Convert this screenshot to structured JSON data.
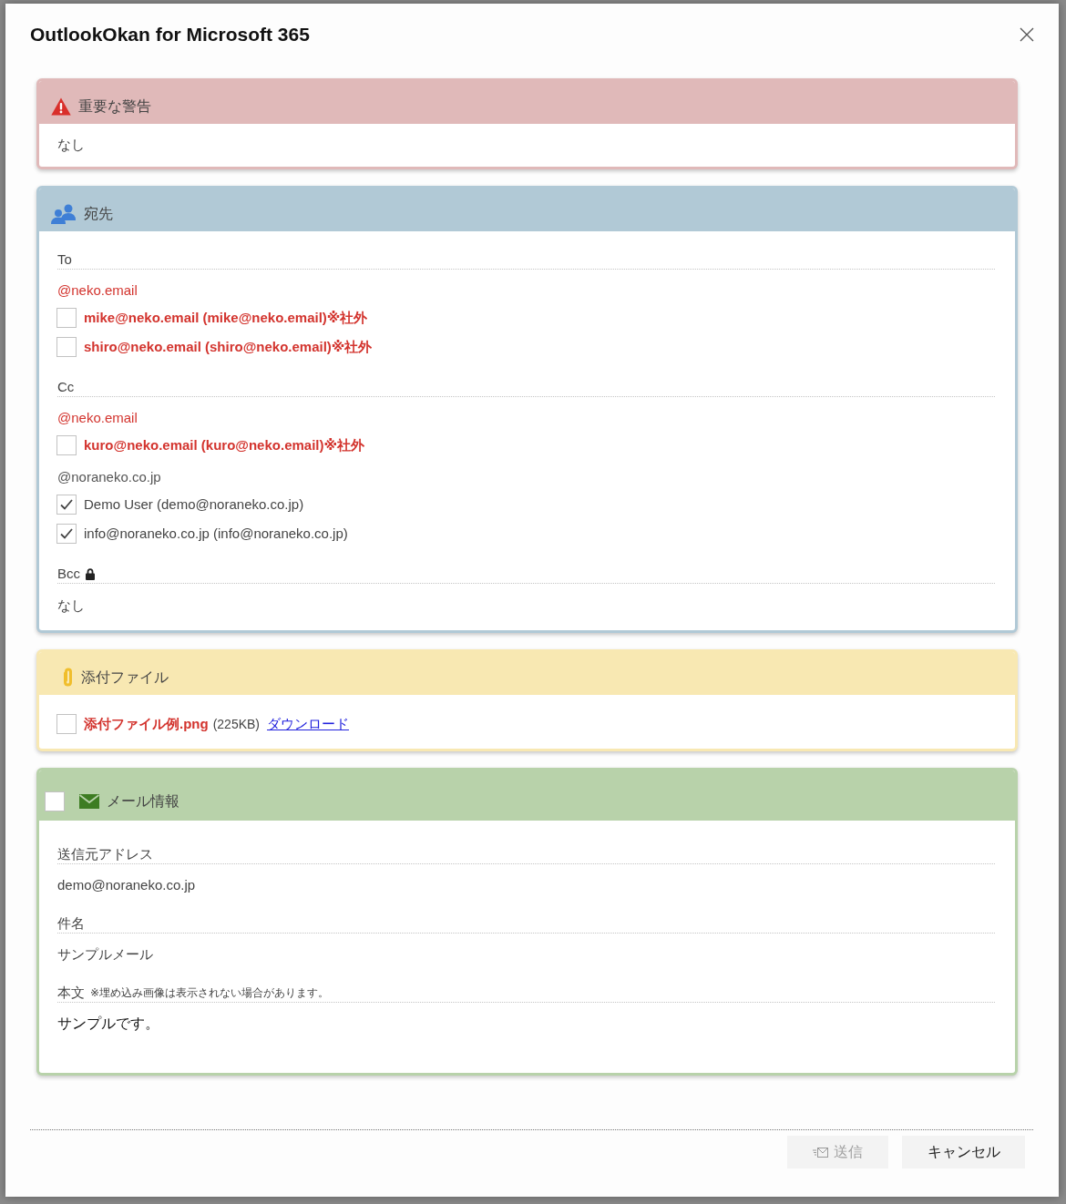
{
  "dialog": {
    "title": "OutlookOkan for Microsoft 365"
  },
  "warnings": {
    "title": "重要な警告",
    "body": "なし"
  },
  "recipients": {
    "title": "宛先",
    "fields": [
      {
        "label": "To",
        "locked": false,
        "groups": [
          {
            "domain": "@neko.email",
            "external": true,
            "entries": [
              {
                "label": "mike@neko.email (mike@neko.email)※社外",
                "checked": false
              },
              {
                "label": "shiro@neko.email (shiro@neko.email)※社外",
                "checked": false
              }
            ]
          }
        ]
      },
      {
        "label": "Cc",
        "locked": false,
        "groups": [
          {
            "domain": "@neko.email",
            "external": true,
            "entries": [
              {
                "label": "kuro@neko.email (kuro@neko.email)※社外",
                "checked": false
              }
            ]
          },
          {
            "domain": "@noraneko.co.jp",
            "external": false,
            "entries": [
              {
                "label": "Demo User (demo@noraneko.co.jp)",
                "checked": true
              },
              {
                "label": "info@noraneko.co.jp (info@noraneko.co.jp)",
                "checked": true
              }
            ]
          }
        ]
      },
      {
        "label": "Bcc",
        "locked": true,
        "empty_text": "なし"
      }
    ]
  },
  "attachments": {
    "title": "添付ファイル",
    "files": [
      {
        "name": "添付ファイル例.png",
        "size": "(225KB)",
        "link": "ダウンロード",
        "checked": false
      }
    ]
  },
  "mail_info": {
    "title": "メール情報",
    "checked": false,
    "fields": [
      {
        "label": "送信元アドレス",
        "value": "demo@noraneko.co.jp",
        "kind": "line"
      },
      {
        "label": "件名",
        "value": "サンプルメール",
        "kind": "line"
      },
      {
        "label": "本文",
        "note": "※埋め込み画像は表示されない場合があります。",
        "value": "サンプルです。",
        "kind": "body"
      }
    ]
  },
  "buttons": [
    {
      "label": "送信",
      "kind": "send",
      "disabled": true
    },
    {
      "label": "キャンセル",
      "kind": "cancel",
      "disabled": false
    }
  ]
}
